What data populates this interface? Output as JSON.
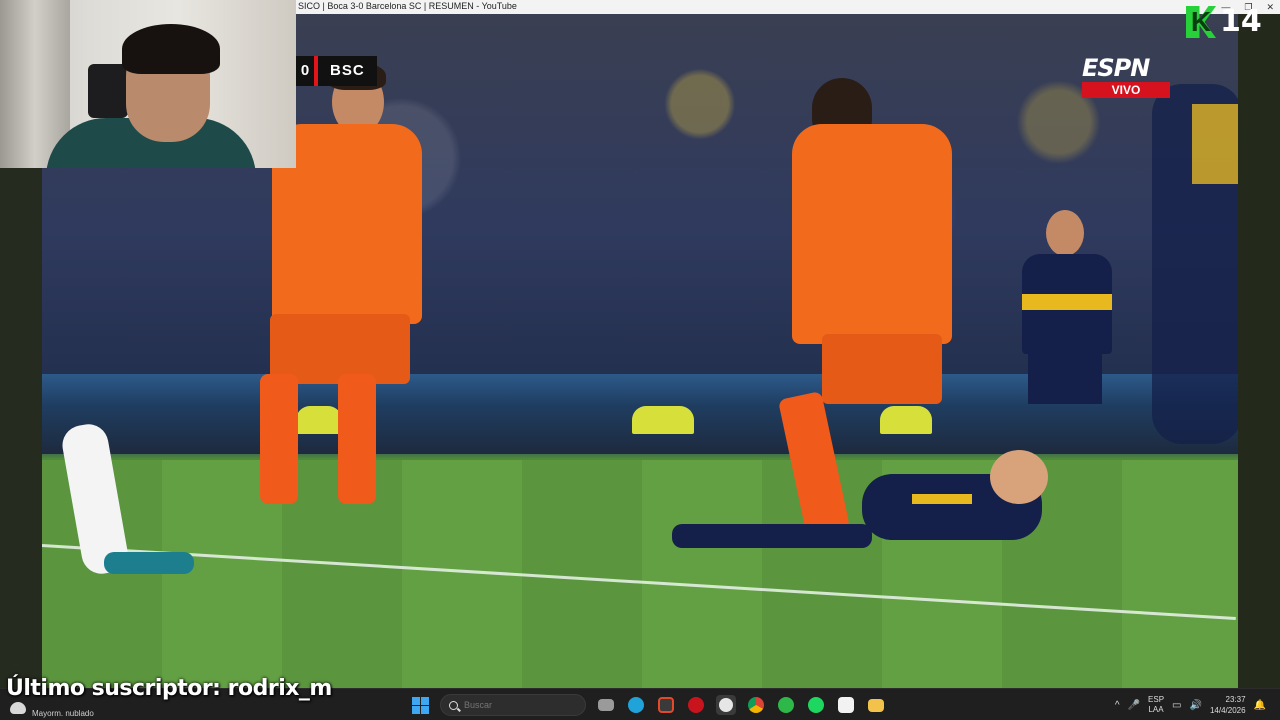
{
  "window": {
    "title": "SICO | Boca 3-0 Barcelona SC | RESUMEN - YouTube"
  },
  "broadcast": {
    "score": "0",
    "team": "BSC",
    "network": "ESPN",
    "live_label": "VIVO",
    "channel_number": "14",
    "channel_letter": "K"
  },
  "stream_overlay": {
    "last_subscriber": "Último suscriptor: rodrix_m"
  },
  "taskbar": {
    "weather": "Mayorm. nublado",
    "search_placeholder": "Buscar",
    "language_top": "ESP",
    "language_bottom": "LAA",
    "time": "23:37",
    "date": "14/4/2026"
  },
  "colors": {
    "espn_red": "#d6121f",
    "channel_green": "#27d13a",
    "barcelona_orange": "#f26a1b",
    "boca_navy": "#14204a",
    "boca_gold": "#e8b81f"
  }
}
